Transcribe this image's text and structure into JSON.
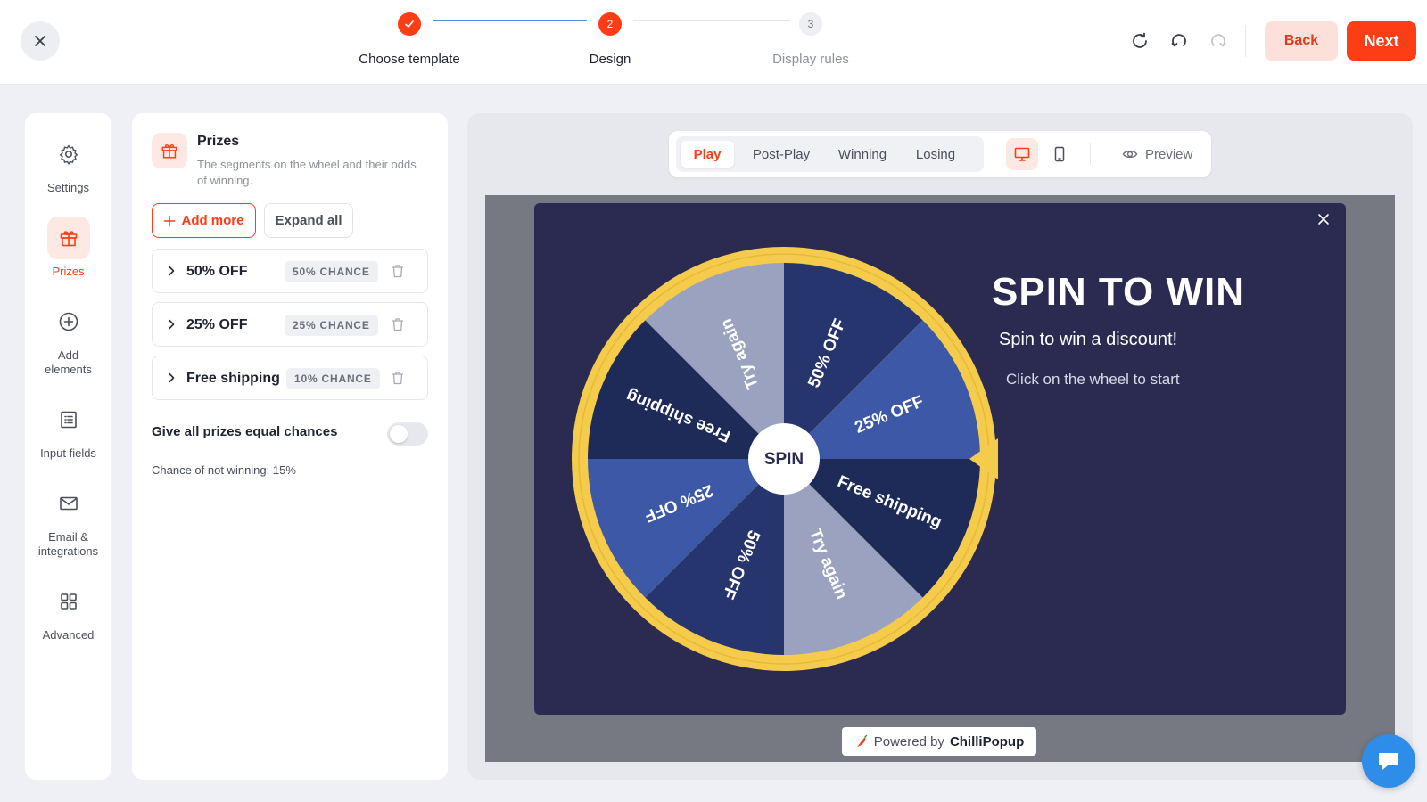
{
  "stepper": {
    "steps": [
      {
        "number": "1",
        "label": "Choose template",
        "state": "done"
      },
      {
        "number": "2",
        "label": "Design",
        "state": "active"
      },
      {
        "number": "3",
        "label": "Display rules",
        "state": "todo"
      }
    ]
  },
  "header": {
    "back_label": "Back",
    "next_label": "Next"
  },
  "sidebar": {
    "items": [
      {
        "label": "Settings",
        "icon": "gear-icon"
      },
      {
        "label": "Prizes",
        "icon": "gift-icon",
        "active": true
      },
      {
        "label": "Add elements",
        "icon": "plus-circle-icon"
      },
      {
        "label": "Input fields",
        "icon": "form-list-icon"
      },
      {
        "label": "Email & integrations",
        "icon": "envelope-icon"
      },
      {
        "label": "Advanced",
        "icon": "grid-icon"
      }
    ]
  },
  "prizes_panel": {
    "title": "Prizes",
    "description": "The segments on the wheel and their odds of winning.",
    "add_more_label": "Add more",
    "expand_all_label": "Expand all",
    "prizes": [
      {
        "name": "50% OFF",
        "chance": "50% CHANCE"
      },
      {
        "name": "25% OFF",
        "chance": "25% CHANCE"
      },
      {
        "name": "Free shipping",
        "chance": "10% CHANCE"
      }
    ],
    "equal_chances_label": "Give all prizes equal chances",
    "equal_chances_on": false,
    "not_winning_note": "Chance of not winning: 15%"
  },
  "preview": {
    "tabs": [
      "Play",
      "Post-Play",
      "Winning",
      "Losing"
    ],
    "active_tab": "Play",
    "preview_label": "Preview",
    "active_device": "desktop"
  },
  "popup": {
    "title": "SPIN TO WIN",
    "subtitle": "Spin to win a discount!",
    "hint": "Click on the wheel to start",
    "spin_label": "SPIN",
    "wheel_segments": [
      "50% OFF",
      "25% OFF",
      "Free shipping",
      "Try again",
      "50% OFF",
      "25% OFF",
      "Free shipping",
      "Try again"
    ],
    "segment_colors": [
      "#26356e",
      "#3d58a6",
      "#1e2a58",
      "#9aa2bf"
    ],
    "rim_color": "#f5cb4b"
  },
  "powered_by": {
    "prefix": "Powered by",
    "brand": "ChilliPopup"
  },
  "colors": {
    "accent": "#fd3d16",
    "accent_light": "#fde8e3",
    "popup_bg": "#2b2b52"
  }
}
